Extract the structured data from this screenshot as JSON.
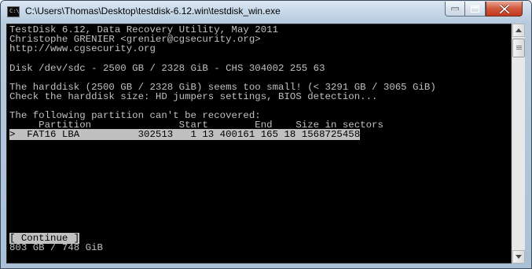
{
  "window": {
    "title": "C:\\Users\\Thomas\\Desktop\\testdisk-6.12.win\\testdisk_win.exe",
    "app_icon_glyph": "C:\\",
    "controls": [
      "minimize",
      "maximize",
      "close"
    ]
  },
  "console": {
    "lines": {
      "l1": "TestDisk 6.12, Data Recovery Utility, May 2011",
      "l2": "Christophe GRENIER <grenier@cgsecurity.org>",
      "l3": "http://www.cgsecurity.org",
      "l4": "Disk /dev/sdc - 2500 GB / 2328 GiB - CHS 304002 255 63",
      "l5": "The harddisk (2500 GB / 2328 GiB) seems too small! (< 3291 GB / 3065 GiB)",
      "l6": "Check the harddisk size: HD jumpers settings, BIOS detection...",
      "l7": "The following partition can't be recovered:",
      "header": "     Partition               Start        End    Size in sectors",
      "partition_row": ">  FAT16 LBA          302513   1 13 400161 165 18 1568725458",
      "continue_button": "[ Continue ]",
      "footer": "803 GB / 748 GiB"
    }
  },
  "scrollbar": {
    "up_icon": "scroll-up-arrow",
    "down_icon": "scroll-down-arrow"
  }
}
